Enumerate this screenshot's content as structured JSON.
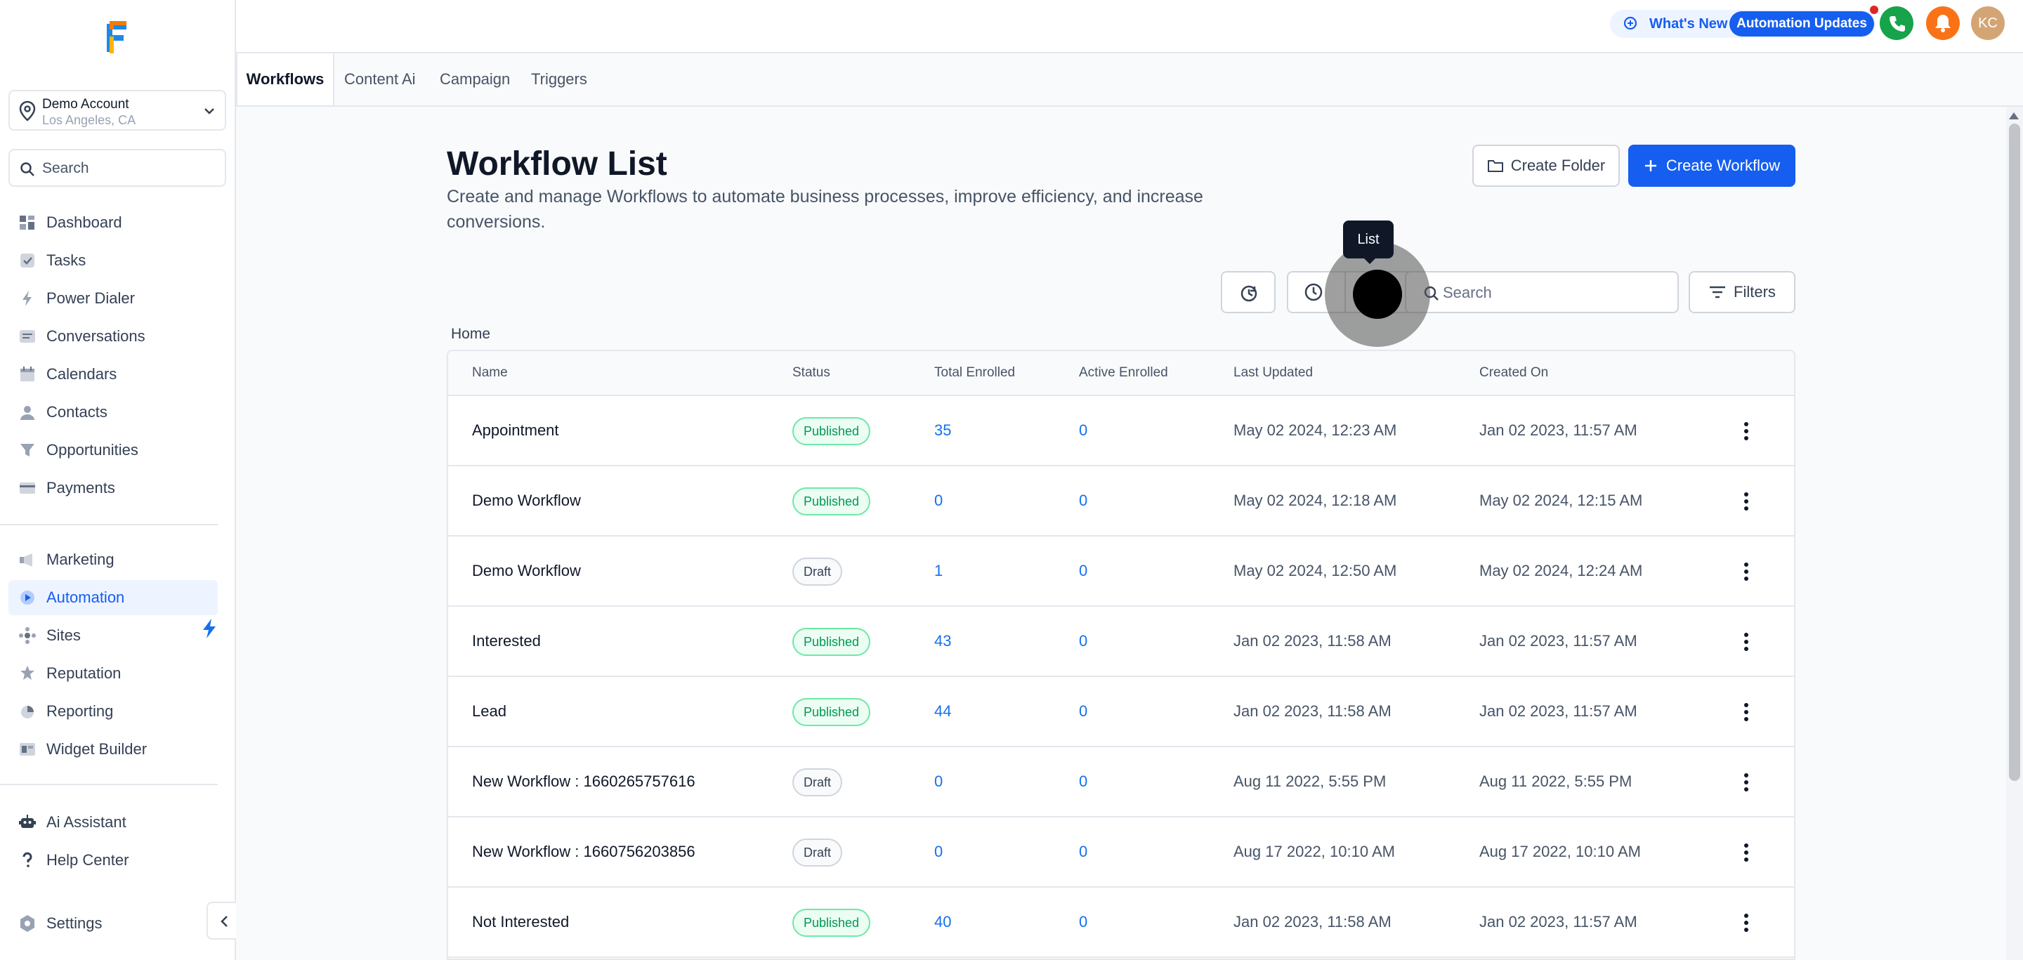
{
  "sidebar": {
    "account": {
      "name": "Demo Account",
      "location": "Los Angeles, CA"
    },
    "search_placeholder": "Search",
    "items_primary": [
      {
        "label": "Dashboard",
        "icon": "dashboard-icon"
      },
      {
        "label": "Tasks",
        "icon": "tasks-icon"
      },
      {
        "label": "Power Dialer",
        "icon": "power-dialer-icon"
      },
      {
        "label": "Conversations",
        "icon": "conversations-icon"
      },
      {
        "label": "Calendars",
        "icon": "calendar-icon"
      },
      {
        "label": "Contacts",
        "icon": "contacts-icon"
      },
      {
        "label": "Opportunities",
        "icon": "opportunities-icon"
      },
      {
        "label": "Payments",
        "icon": "payments-icon"
      }
    ],
    "items_secondary": [
      {
        "label": "Marketing",
        "icon": "marketing-icon"
      },
      {
        "label": "Automation",
        "icon": "automation-icon",
        "active": true
      },
      {
        "label": "Sites",
        "icon": "sites-icon"
      },
      {
        "label": "Reputation",
        "icon": "reputation-icon"
      },
      {
        "label": "Reporting",
        "icon": "reporting-icon"
      },
      {
        "label": "Widget Builder",
        "icon": "widget-builder-icon"
      }
    ],
    "items_bottom": [
      {
        "label": "Ai Assistant",
        "icon": "robot-icon"
      },
      {
        "label": "Help Center",
        "icon": "question-icon"
      },
      {
        "label": "Settings",
        "icon": "settings-icon"
      }
    ]
  },
  "topbar": {
    "whats_new": "What's New",
    "automation_updates": "Automation Updates",
    "avatar_initials": "KC"
  },
  "tabs": [
    "Workflows",
    "Content Ai",
    "Campaign",
    "Triggers"
  ],
  "page": {
    "title": "Workflow List",
    "description": "Create and manage Workflows to automate business processes, improve efficiency, and increase conversions.",
    "create_folder": "Create Folder",
    "create_workflow": "Create Workflow",
    "search_placeholder": "Search",
    "filters": "Filters",
    "tooltip": "List",
    "breadcrumb": "Home"
  },
  "table": {
    "columns": [
      "Name",
      "Status",
      "Total Enrolled",
      "Active Enrolled",
      "Last Updated",
      "Created On"
    ],
    "rows": [
      {
        "name": "Appointment",
        "status": "Published",
        "total": "35",
        "active": "0",
        "updated": "May 02 2024, 12:23 AM",
        "created": "Jan 02 2023, 11:57 AM"
      },
      {
        "name": "Demo Workflow",
        "status": "Published",
        "total": "0",
        "active": "0",
        "updated": "May 02 2024, 12:18 AM",
        "created": "May 02 2024, 12:15 AM"
      },
      {
        "name": "Demo Workflow",
        "status": "Draft",
        "total": "1",
        "active": "0",
        "updated": "May 02 2024, 12:50 AM",
        "created": "May 02 2024, 12:24 AM"
      },
      {
        "name": "Interested",
        "status": "Published",
        "total": "43",
        "active": "0",
        "updated": "Jan 02 2023, 11:58 AM",
        "created": "Jan 02 2023, 11:57 AM"
      },
      {
        "name": "Lead",
        "status": "Published",
        "total": "44",
        "active": "0",
        "updated": "Jan 02 2023, 11:58 AM",
        "created": "Jan 02 2023, 11:57 AM"
      },
      {
        "name": "New Workflow : 1660265757616",
        "status": "Draft",
        "total": "0",
        "active": "0",
        "updated": "Aug 11 2022, 5:55 PM",
        "created": "Aug 11 2022, 5:55 PM"
      },
      {
        "name": "New Workflow : 1660756203856",
        "status": "Draft",
        "total": "0",
        "active": "0",
        "updated": "Aug 17 2022, 10:10 AM",
        "created": "Aug 17 2022, 10:10 AM"
      },
      {
        "name": "Not Interested",
        "status": "Published",
        "total": "40",
        "active": "0",
        "updated": "Jan 02 2023, 11:58 AM",
        "created": "Jan 02 2023, 11:57 AM"
      }
    ]
  },
  "colors": {
    "accent": "#155eef",
    "published": "#039855",
    "link_number": "#1570ef"
  }
}
